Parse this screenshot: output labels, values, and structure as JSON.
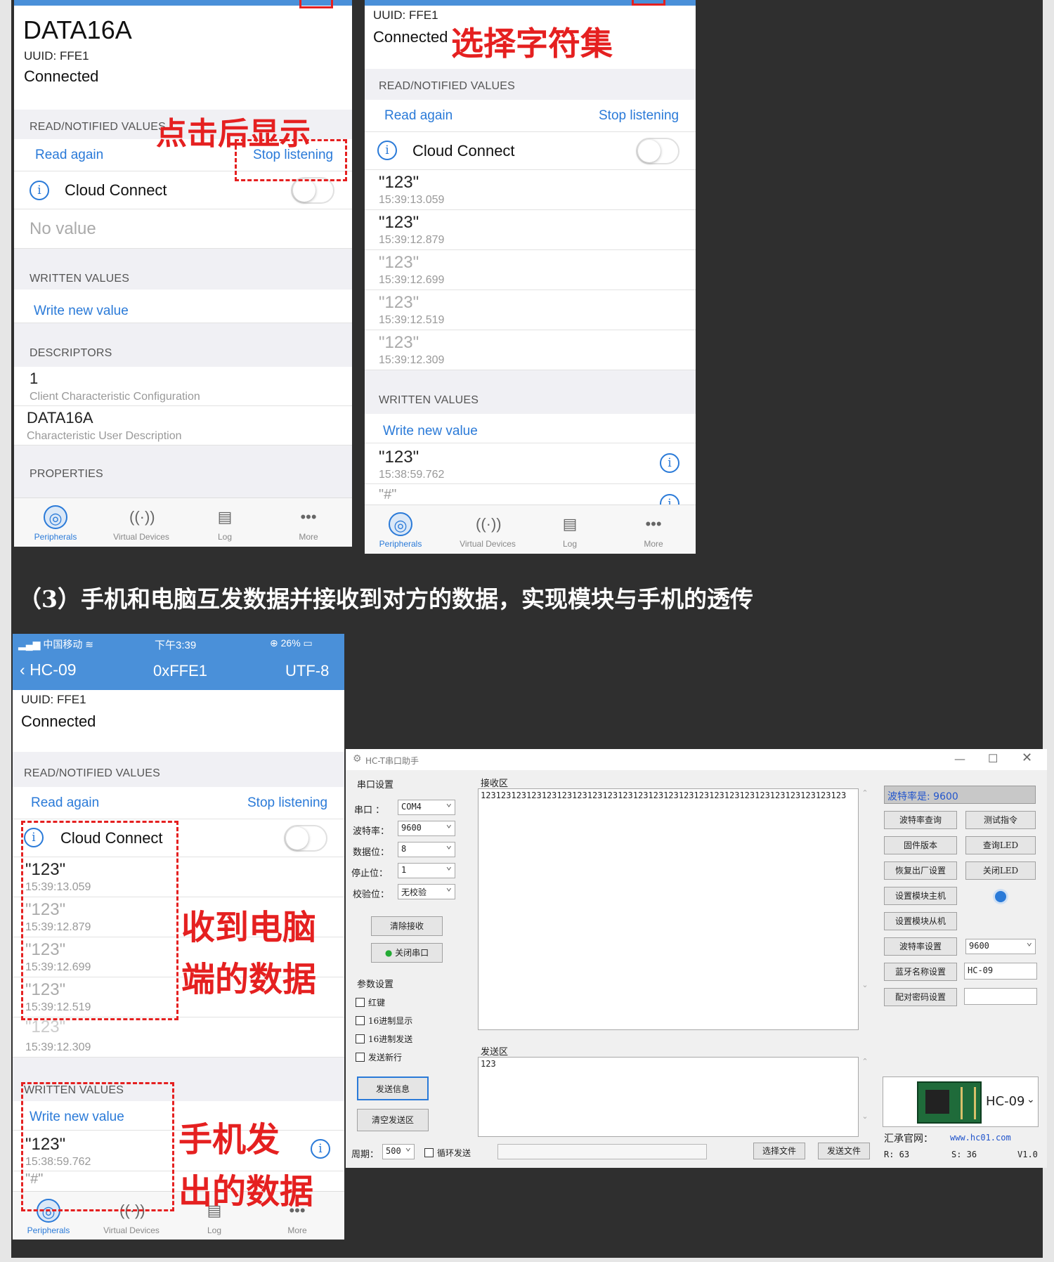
{
  "phone1": {
    "device_name": "DATA16A",
    "uuid": "UUID: FFE1",
    "status": "Connected",
    "read_section": "READ/NOTIFIED VALUES",
    "read_again": "Read again",
    "stop_listening": "Stop listening",
    "cloud_connect": "Cloud Connect",
    "no_value": "No value",
    "written_section": "WRITTEN VALUES",
    "write_new": "Write new value",
    "descriptors_section": "DESCRIPTORS",
    "desc1_value": "1",
    "desc1_label": "Client Characteristic Configuration",
    "desc2_value": "DATA16A",
    "desc2_label": "Characteristic User Description",
    "properties_section": "PROPERTIES",
    "annotation": "点击后显示"
  },
  "phone2": {
    "uuid": "UUID: FFE1",
    "status": "Connected",
    "annotation": "选择字符集",
    "read_section": "READ/NOTIFIED VALUES",
    "read_again": "Read again",
    "stop_listening": "Stop listening",
    "cloud_connect": "Cloud Connect",
    "values": [
      {
        "v": "\"123\"",
        "t": "15:39:13.059"
      },
      {
        "v": "\"123\"",
        "t": "15:39:12.879"
      },
      {
        "v": "\"123\"",
        "t": "15:39:12.699"
      },
      {
        "v": "\"123\"",
        "t": "15:39:12.519"
      },
      {
        "v": "\"123\"",
        "t": "15:39:12.309"
      }
    ],
    "written_section": "WRITTEN VALUES",
    "write_new": "Write new value",
    "written": [
      {
        "v": "\"123\"",
        "t": "15:38:59.762"
      },
      {
        "v": "\"#\"",
        "t": ""
      }
    ]
  },
  "tabs": {
    "peripherals": "Peripherals",
    "virtual": "Virtual Devices",
    "log": "Log",
    "more": "More"
  },
  "caption": "（3）手机和电脑互发数据并接收到对方的数据，实现模块与手机的透传",
  "phone3": {
    "carrier": "中国移动",
    "time": "下午3:39",
    "battery": "26%",
    "back": "HC-09",
    "title": "0xFFE1",
    "charset": "UTF-8",
    "uuid": "UUID: FFE1",
    "status": "Connected",
    "read_section": "READ/NOTIFIED VALUES",
    "read_again": "Read again",
    "stop_listening": "Stop listening",
    "cloud_connect": "Cloud Connect",
    "values": [
      {
        "v": "\"123\"",
        "t": "15:39:13.059"
      },
      {
        "v": "\"123\"",
        "t": "15:39:12.879"
      },
      {
        "v": "\"123\"",
        "t": "15:39:12.699"
      },
      {
        "v": "\"123\"",
        "t": "15:39:12.519"
      },
      {
        "v": "\"123\"",
        "t": "15:39:12.309"
      }
    ],
    "written_section": "WRITTEN VALUES",
    "write_new": "Write new value",
    "written": [
      {
        "v": "\"123\"",
        "t": "15:38:59.762"
      },
      {
        "v": "\"#\"",
        "t": ""
      }
    ],
    "annot_recv_1": "收到电脑",
    "annot_recv_2": "端的数据",
    "annot_sent_1": "手机发",
    "annot_sent_2": "出的数据"
  },
  "window": {
    "title": "HC-T串口助手",
    "port_group": "串口设置",
    "port_label": "串口",
    "port_value": "COM4",
    "baud_label": "波特率：",
    "baud_value": "9600",
    "data_label": "数据位：",
    "data_value": "8",
    "stop_label": "停止位：",
    "stop_value": "1",
    "parity_label": "校验位：",
    "parity_value": "无校验",
    "clear_recv": "清除接收",
    "close_port": "关闭串口",
    "param_group": "参数设置",
    "chk_hex": "红键",
    "chk_hex_show": "16进制显示",
    "chk_hex_send": "16进制发送",
    "chk_newline": "发送新行",
    "send_btn": "发送信息",
    "clear_send": "清空发送区",
    "recv_label": "接收区",
    "recv_text": "123123123123123123123123123123123123123123123123123123123123123123123123",
    "send_label": "发送区",
    "send_text": "123",
    "period_label": "周期：",
    "period_value": "500",
    "loop_send": "循环发送",
    "choose_file": "选择文件",
    "send_file": "发送文件",
    "rate_display": "波特率是: 9600",
    "b_query_baud": "波特率查询",
    "b_test": "测试指令",
    "b_firmware": "固件版本",
    "b_query_led": "查询LED",
    "b_factory": "恢复出厂设置",
    "b_close_led": "关闭LED",
    "b_master": "设置模块主机",
    "b_slave": "设置模块从机",
    "b_set_baud": "波特率设置",
    "set_baud_value": "9600",
    "b_name": "蓝牙名称设置",
    "name_value": "HC-09",
    "b_pin": "配对密码设置",
    "pin_value": "",
    "module_name": "HC-09",
    "website_label": "汇承官网：",
    "website": "www.hc01.com",
    "r_count": "R: 63",
    "s_count": "S: 36",
    "version": "V1.0"
  }
}
